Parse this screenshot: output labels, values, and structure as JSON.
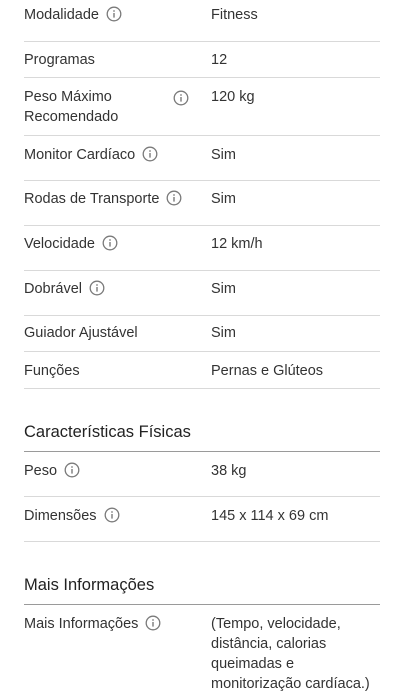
{
  "general_rows": [
    {
      "label": "Modalidade",
      "value": "Fitness",
      "info": true
    },
    {
      "label": "Programas",
      "value": "12",
      "info": false
    },
    {
      "label": "Peso Máximo Recomendado",
      "value": "120 kg",
      "info": true
    },
    {
      "label": "Monitor Cardíaco",
      "value": "Sim",
      "info": true
    },
    {
      "label": "Rodas de Transporte",
      "value": "Sim",
      "info": true
    },
    {
      "label": "Velocidade",
      "value": "12 km/h",
      "info": true
    },
    {
      "label": "Dobrável",
      "value": "Sim",
      "info": true
    },
    {
      "label": "Guiador Ajustável",
      "value": "Sim",
      "info": false
    },
    {
      "label": "Funções",
      "value": "Pernas e Glúteos",
      "info": false
    }
  ],
  "physical": {
    "title": "Características Físicas",
    "rows": [
      {
        "label": "Peso",
        "value": "38 kg",
        "info": true
      },
      {
        "label": "Dimensões",
        "value": "145 x 114 x 69 cm",
        "info": true
      }
    ]
  },
  "more_info": {
    "title": "Mais Informações",
    "rows": [
      {
        "label": "Mais Informações",
        "value": "(Tempo, velocidade, distância, calorias queimadas e monitorização cardíaca.)",
        "info": true
      }
    ]
  },
  "icons": {
    "info": "info-circle-icon"
  },
  "colors": {
    "text": "#333333",
    "divider": "#d9d9d9",
    "section_rule": "#9a9a9a",
    "icon": "#7a7a7a"
  }
}
